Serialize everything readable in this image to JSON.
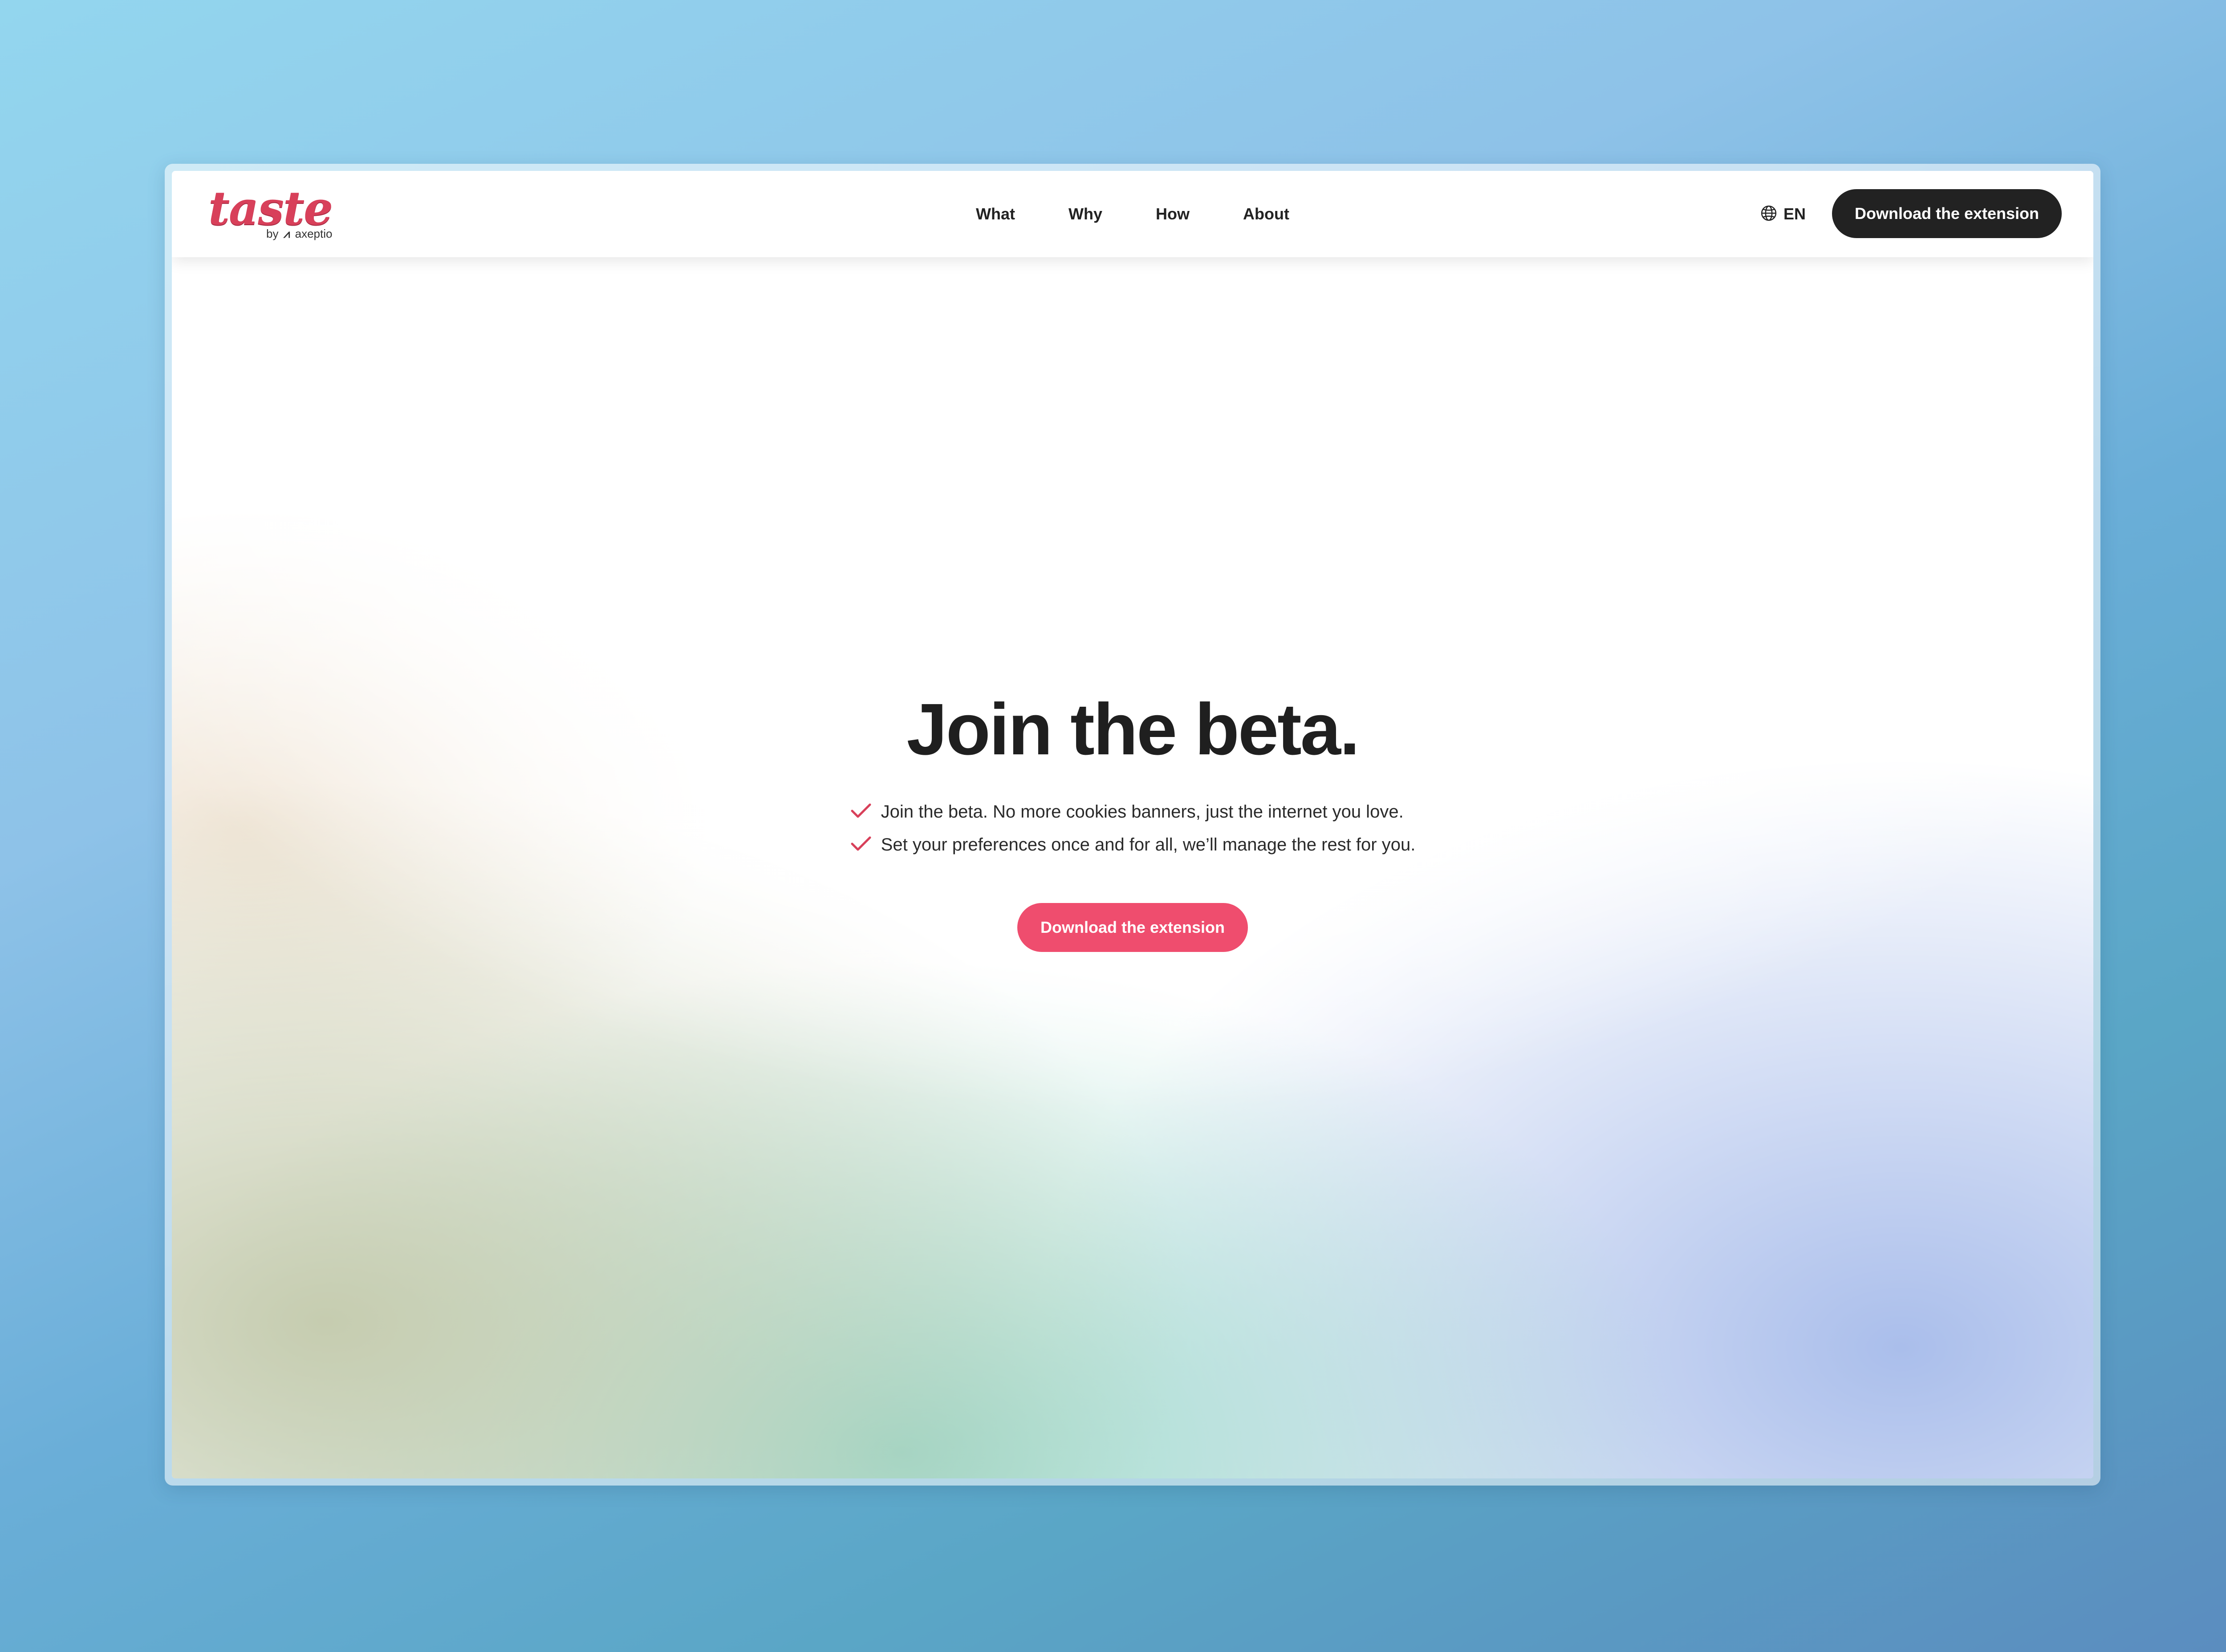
{
  "header": {
    "logo": {
      "wordmark": "taste",
      "byline_prefix": "by",
      "byline_mark": "⩘",
      "byline_brand": "axeptio"
    },
    "nav": [
      {
        "label": "What"
      },
      {
        "label": "Why"
      },
      {
        "label": "How"
      },
      {
        "label": "About"
      }
    ],
    "language": {
      "label": "EN",
      "icon": "globe-icon"
    },
    "cta_label": "Download the extension"
  },
  "hero": {
    "title": "Join the beta.",
    "bullets": [
      {
        "text": "Join the beta. No more cookies banners, just the internet you love.",
        "icon": "check-icon"
      },
      {
        "text": "Set your preferences once and for all, we’ll manage the rest for you.",
        "icon": "check-icon"
      }
    ],
    "cta_label": "Download the extension"
  },
  "colors": {
    "accent": "#ef4d6e",
    "logo": "#d8405a",
    "dark_button": "#222222",
    "text": "#1f1f1f"
  }
}
